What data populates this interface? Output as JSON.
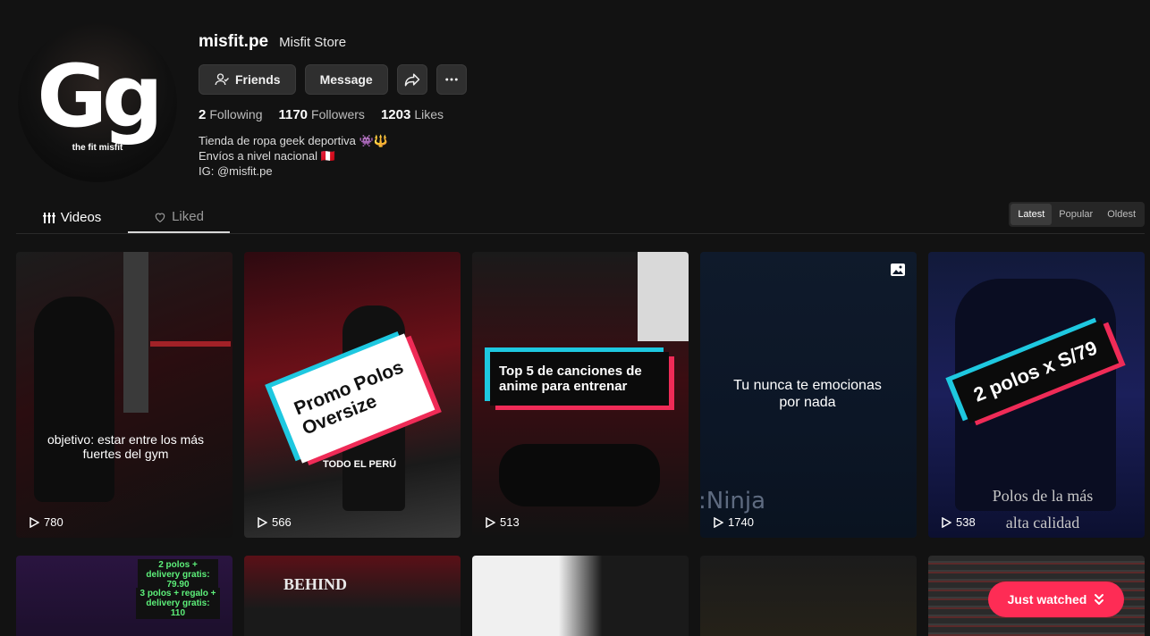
{
  "profile": {
    "username": "misfit.pe",
    "nickname": "Misfit Store",
    "avatar_logo": "Gg",
    "avatar_tag": "the fit misfit",
    "buttons": {
      "friends": "Friends",
      "message": "Message"
    },
    "stats": {
      "following_count": "2",
      "following_label": "Following",
      "followers_count": "1170",
      "followers_label": "Followers",
      "likes_count": "1203",
      "likes_label": "Likes"
    },
    "bio": [
      "Tienda de ropa geek deportiva 👾🔱",
      "Envíos a nivel nacional 🇵🇪",
      "IG: @misfit.pe"
    ]
  },
  "tabs": {
    "videos": "Videos",
    "liked": "Liked"
  },
  "sort": {
    "latest": "Latest",
    "popular": "Popular",
    "oldest": "Oldest"
  },
  "videos": [
    {
      "views": "780",
      "caption": "objetivo: estar entre los más fuertes del gym"
    },
    {
      "views": "566",
      "sticker": "Promo Polos Oversize",
      "subtext": "TODO EL PERÚ"
    },
    {
      "views": "513",
      "sticker": "Top 5 de canciones de anime para entrenar"
    },
    {
      "views": "1740",
      "caption": "Tu nunca te emocionas por nada",
      "watermark": ":Ninja"
    },
    {
      "views": "538",
      "sticker": "2 polos x S/79",
      "caption": "Polos de la más alta calidad"
    }
  ],
  "row2": {
    "promo_line1": "2 polos + delivery gratis: 79.90",
    "promo_line2": "3 polos + regalo + delivery gratis: 110",
    "shirt_text": "BEHIND"
  },
  "just_watched": "Just watched",
  "colors": {
    "accent": "#fe2c55",
    "cyan": "#1ec8e0",
    "bg": "#121212"
  }
}
